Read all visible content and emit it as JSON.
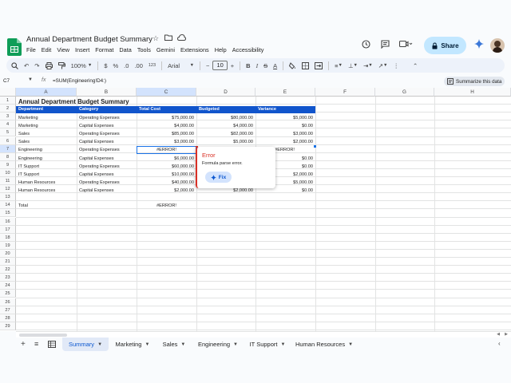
{
  "doc": {
    "title": "Annual Department Budget Summary",
    "menus": [
      "File",
      "Edit",
      "View",
      "Insert",
      "Format",
      "Data",
      "Tools",
      "Gemini",
      "Extensions",
      "Help",
      "Accessibility"
    ],
    "share_label": "Share"
  },
  "toolbar": {
    "zoom": "100%",
    "currency": "$",
    "percent": "%",
    "dec_dec": ".0",
    "dec_inc": ".00",
    "num_fmt": "123",
    "font": "Arial",
    "font_size": "10"
  },
  "formula_bar": {
    "cell_ref": "C7",
    "fx": "fx",
    "formula": "=SUM(Engineering!D4:)",
    "summarize_label": "Summarize this data"
  },
  "columns": [
    "A",
    "B",
    "C",
    "D",
    "E",
    "F",
    "G",
    "H"
  ],
  "rows": [
    "1",
    "2",
    "3",
    "4",
    "5",
    "6",
    "7",
    "8",
    "9",
    "10",
    "11",
    "12",
    "13",
    "14",
    "15",
    "16",
    "17",
    "18",
    "19",
    "20",
    "21",
    "22",
    "23",
    "24",
    "25",
    "26",
    "27",
    "28",
    "29"
  ],
  "sheet": {
    "title": "Annual Department Budget Summary",
    "headers": [
      "Department",
      "Category",
      "Total Cost",
      "Budgeted",
      "Variance"
    ],
    "data": [
      [
        "Marketing",
        "Operating Expenses",
        "$75,000.00",
        "$80,000.00",
        "$5,000.00"
      ],
      [
        "Marketing",
        "Capital Expenses",
        "$4,000.00",
        "$4,000.00",
        "$0.00"
      ],
      [
        "Sales",
        "Operating Expenses",
        "$85,000.00",
        "$82,000.00",
        "$3,000.00"
      ],
      [
        "Sales",
        "Capital Expenses",
        "$3,000.00",
        "$5,000.00",
        "$2,000.00"
      ],
      [
        "Engineering",
        "Operating Expenses",
        "#ERROR!",
        "",
        "#ERROR!"
      ],
      [
        "Engineering",
        "Capital Expenses",
        "$6,000.00",
        "",
        "$0.00"
      ],
      [
        "IT Support",
        "Operating Expenses",
        "$60,000.00",
        "",
        "$0.00"
      ],
      [
        "IT Support",
        "Capital Expenses",
        "$10,000.00",
        "",
        "$2,000.00"
      ],
      [
        "Human Resources",
        "Operating Expenses",
        "$40,000.00",
        "",
        "$5,000.00"
      ],
      [
        "Human Resources",
        "Capital Expenses",
        "$2,000.00",
        "$2,000.00",
        "$0.00"
      ]
    ],
    "total_label": "Total",
    "total_value": "#ERROR!"
  },
  "error_popup": {
    "title": "Error",
    "message": "Formula parse error.",
    "fix_label": "Fix"
  },
  "tabs": [
    "Summary",
    "Marketing",
    "Sales",
    "Engineering",
    "IT Support",
    "Human Resources"
  ],
  "active_tab": "Summary",
  "colors": {
    "header_blue": "#1155cc",
    "error_red": "#d93025",
    "share_bg": "#c2e7ff"
  }
}
